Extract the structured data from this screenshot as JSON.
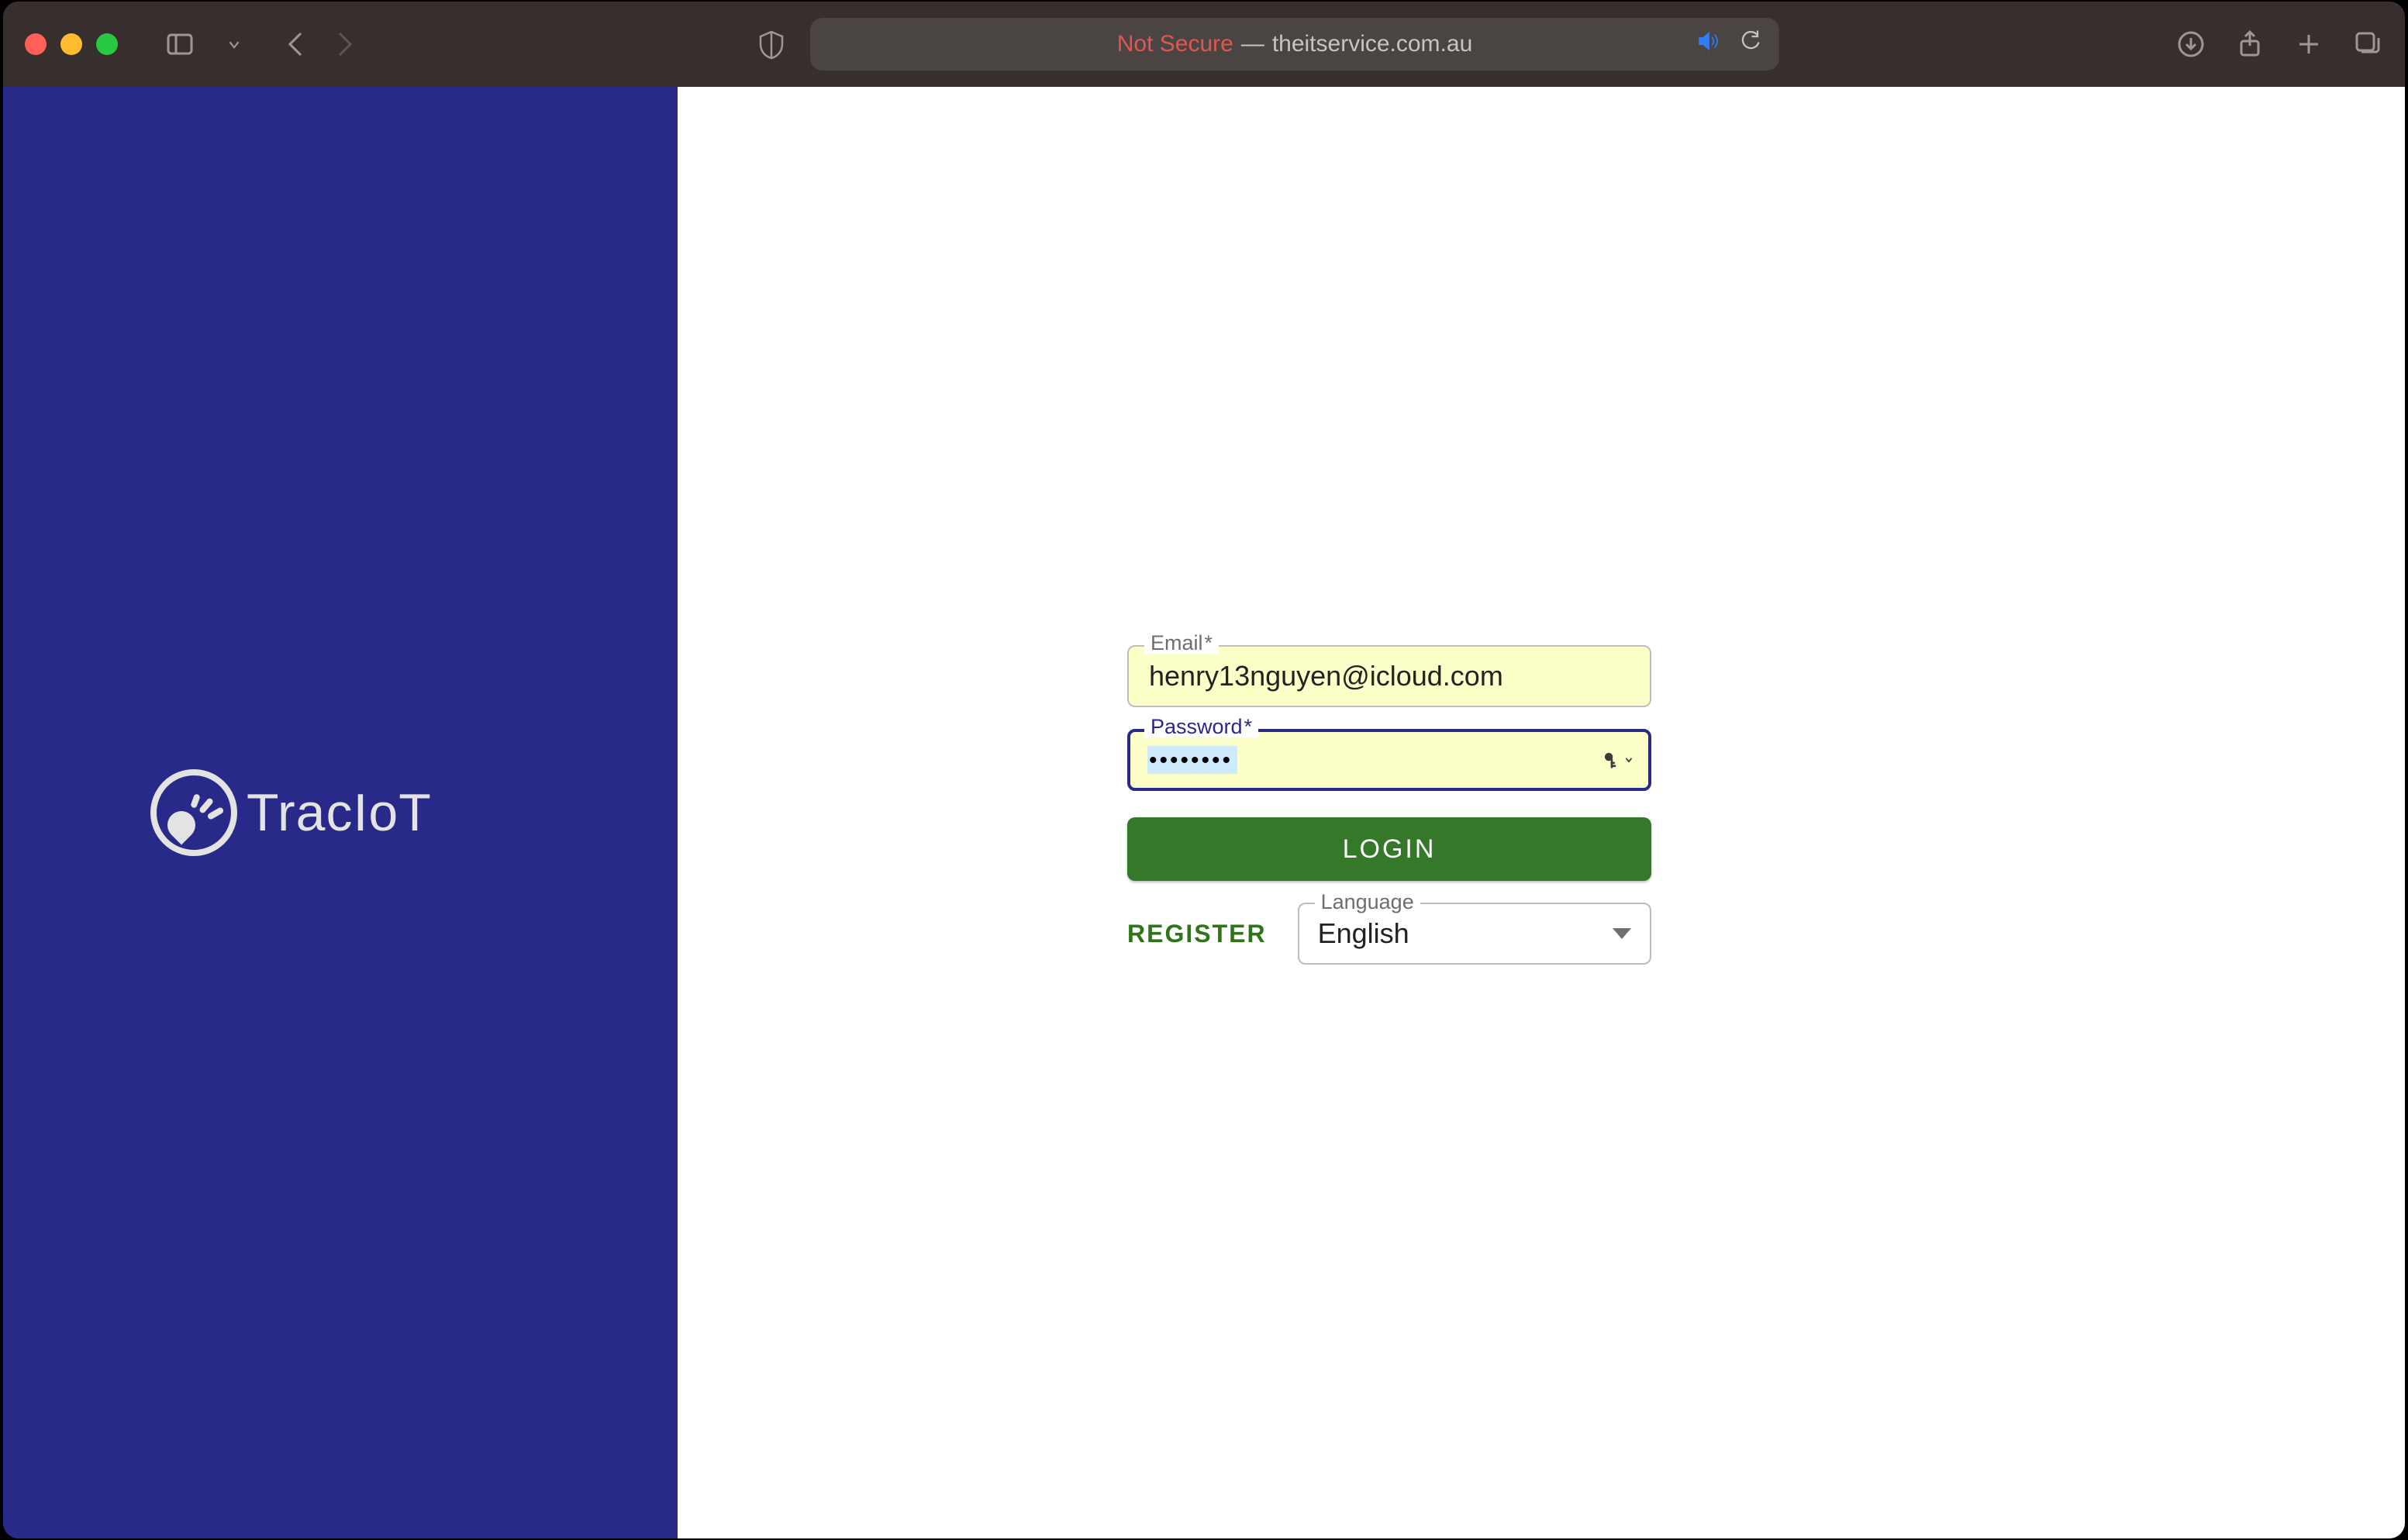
{
  "browser": {
    "url_not_secure": "Not Secure",
    "url_host": "theitservice.com.au"
  },
  "brand": {
    "name": "TracIoT"
  },
  "form": {
    "email": {
      "label": "Email",
      "required_mark": "*",
      "value": "henry13nguyen@icloud.com"
    },
    "password": {
      "label": "Password",
      "required_mark": "*",
      "value_masked": "••••••••"
    },
    "login_label": "LOGIN",
    "register_label": "REGISTER",
    "language": {
      "label": "Language",
      "value": "English"
    }
  }
}
